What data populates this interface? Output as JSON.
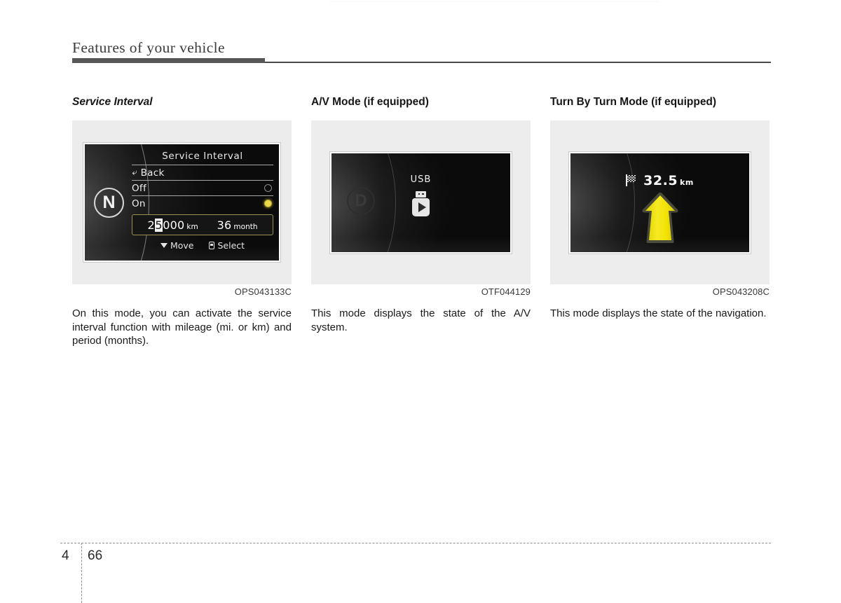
{
  "page": {
    "header_title": "Features of your vehicle",
    "footer_chapter": "4",
    "footer_page": "66"
  },
  "columns": [
    {
      "heading": "Service Interval",
      "figure_code": "OPS043133C",
      "body": "On this mode, you can activate the service interval function with mileage (mi. or km) and period (months).",
      "screen": {
        "gear_indicator": "N",
        "title": "Service Interval",
        "back_label": "Back",
        "back_icon": "back-arrow-icon",
        "options": [
          {
            "label": "Off",
            "selected": false
          },
          {
            "label": "On",
            "selected": true
          }
        ],
        "value_mileage_prefix": "2",
        "value_mileage_highlighted_digit": "5",
        "value_mileage_suffix": "000",
        "value_mileage_unit": "km",
        "value_period": "36",
        "value_period_unit": "month",
        "footer_move": "Move",
        "footer_select": "Select",
        "move_icon": "caret-down-icon",
        "select_icon": "select-button-icon"
      }
    },
    {
      "heading": "A/V Mode (if equipped)",
      "figure_code": "OTF044129",
      "body": "This mode displays the state of the A/V system.",
      "screen": {
        "gear_indicator": "D",
        "source_label": "USB",
        "source_icon": "usb-drive-play-icon"
      }
    },
    {
      "heading": "Turn By Turn Mode (if equipped)",
      "figure_code": "OPS043208C",
      "body": "This mode displays the state of the navigation.",
      "screen": {
        "destination_icon": "checkered-flag-icon",
        "distance_value": "32.5",
        "distance_unit": "km",
        "direction_icon": "straight-ahead-arrow-icon",
        "arrow_color": "#f2e205"
      }
    }
  ]
}
